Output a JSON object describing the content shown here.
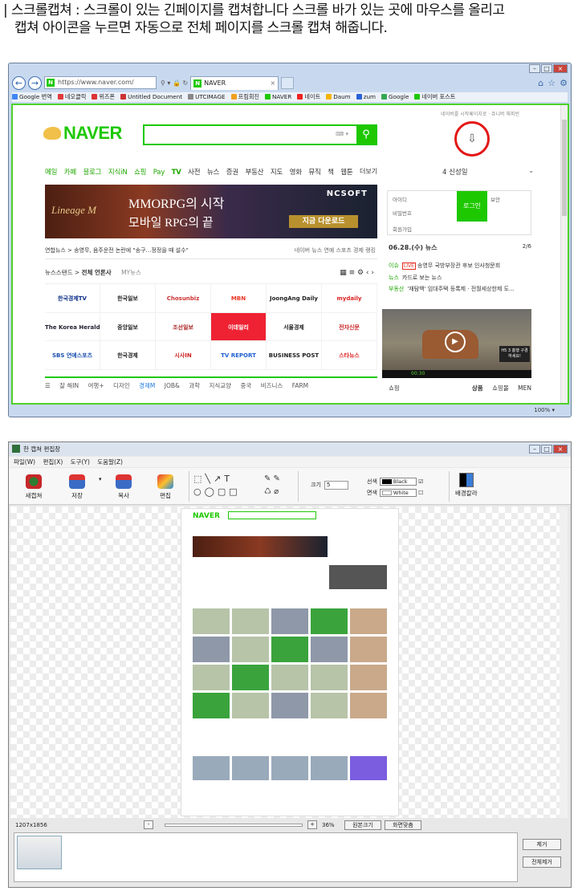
{
  "caption": {
    "line1": "| 스크롤캡쳐 : 스크롤이 있는 긴페이지를 캡쳐합니다 스크롤 바가 있는 곳에 마우스를 올리고",
    "line2": "캡쳐 아이콘을 누르면 자동으로 전체 페이지를 스크롤 캡쳐 해줍니다."
  },
  "browser": {
    "url": "https://www.naver.com/",
    "tab_title": "NAVER",
    "favorites": [
      "Google 번역",
      "네오클릭",
      "위즈폰",
      "Untitled Document",
      "UTCIMAGE",
      "프림회진",
      "NAVER",
      "네이트",
      "Daum",
      "zum",
      "Google",
      "네이버 포스트"
    ],
    "zoom": "100%"
  },
  "naver": {
    "logo": "NAVER",
    "toplinks": "네이버를 시작페이지로 · 쥬니버 해피빈",
    "nav": [
      "메일",
      "카페",
      "블로그",
      "지식iN",
      "쇼핑",
      "Pay",
      "TV",
      "사전",
      "뉴스",
      "증권",
      "부동산",
      "지도",
      "영화",
      "뮤직",
      "책",
      "웹툰"
    ],
    "more": "더보기",
    "weather": "4 신성일",
    "banner": {
      "brand": "Lineage M",
      "line1": "MMORPG의 시작",
      "line2": "모바일 RPG의 끝",
      "corp": "NCSOFT",
      "cta": "지금 다운로드"
    },
    "login": {
      "id": "아이디",
      "pw": "비밀번호",
      "btn": "로그인",
      "secure": "보안",
      "find": "회원가입"
    },
    "newsbar": {
      "headline": "연합뉴스 > 송영무, 음주운전 논란에 \"송구…정정을 때 설수\"",
      "right": "네이버 뉴스 연예 스포츠 경제 랭킹"
    },
    "stand": {
      "label": "뉴스스탠드 >",
      "all": "전체 언론사",
      "my": "MY뉴스"
    },
    "press": [
      "한국경제TV",
      "한국일보",
      "Chosunbiz",
      "MBN",
      "JoongAng Daily",
      "mydaily",
      "The Korea Herald",
      "중앙일보",
      "조선일보",
      "이데일리",
      "서울경제",
      "전자신문",
      "SBS 연예스포츠",
      "한국경제",
      "시사IN",
      "TV REPORT",
      "BUSINESS POST",
      "스타뉴스"
    ],
    "cats": [
      "잘 해IN",
      "여행+",
      "디자인",
      "경제M",
      "JOB&",
      "과학",
      "지식교양",
      "중국",
      "비즈니스",
      "FARM"
    ],
    "rnews": {
      "date": "06.28.(수) 뉴스",
      "page": "2/6",
      "items": [
        {
          "tag": "이슈",
          "live": "LIVE",
          "text": "송영무 국방부장관 후보 인사청문회"
        },
        {
          "tag": "뉴스",
          "live": "",
          "text": "카드로 보는 뉴스"
        },
        {
          "tag": "부동산",
          "live": "",
          "text": "'재탐백' 임대주택 등록제 · 전월세상한제 도..."
        }
      ]
    },
    "video": {
      "time": "00:30",
      "label": "H5 3 흥행 구경 하세요!"
    },
    "shop": {
      "label": "쇼핑",
      "tabs": [
        "상품",
        "쇼핑몰",
        "MEN"
      ]
    }
  },
  "editor": {
    "title": "한 캡쳐 편집창",
    "menu": [
      "파일(W)",
      "편집(X)",
      "도구(Y)",
      "도움말(Z)"
    ],
    "tools": [
      "새캡쳐",
      "저장",
      "복사",
      "편집"
    ],
    "size_label": "크기",
    "size_value": "5",
    "line_label": "선색",
    "line_value": "Black",
    "fill_label": "면색",
    "fill_value": "White",
    "bgcolor": "배경칼라",
    "dims": "1207x1856",
    "zoom": "36%",
    "btn_original": "원본크기",
    "btn_fit": "화면맞춤",
    "btn_remove": "제거",
    "btn_remove_all": "전체제거"
  }
}
